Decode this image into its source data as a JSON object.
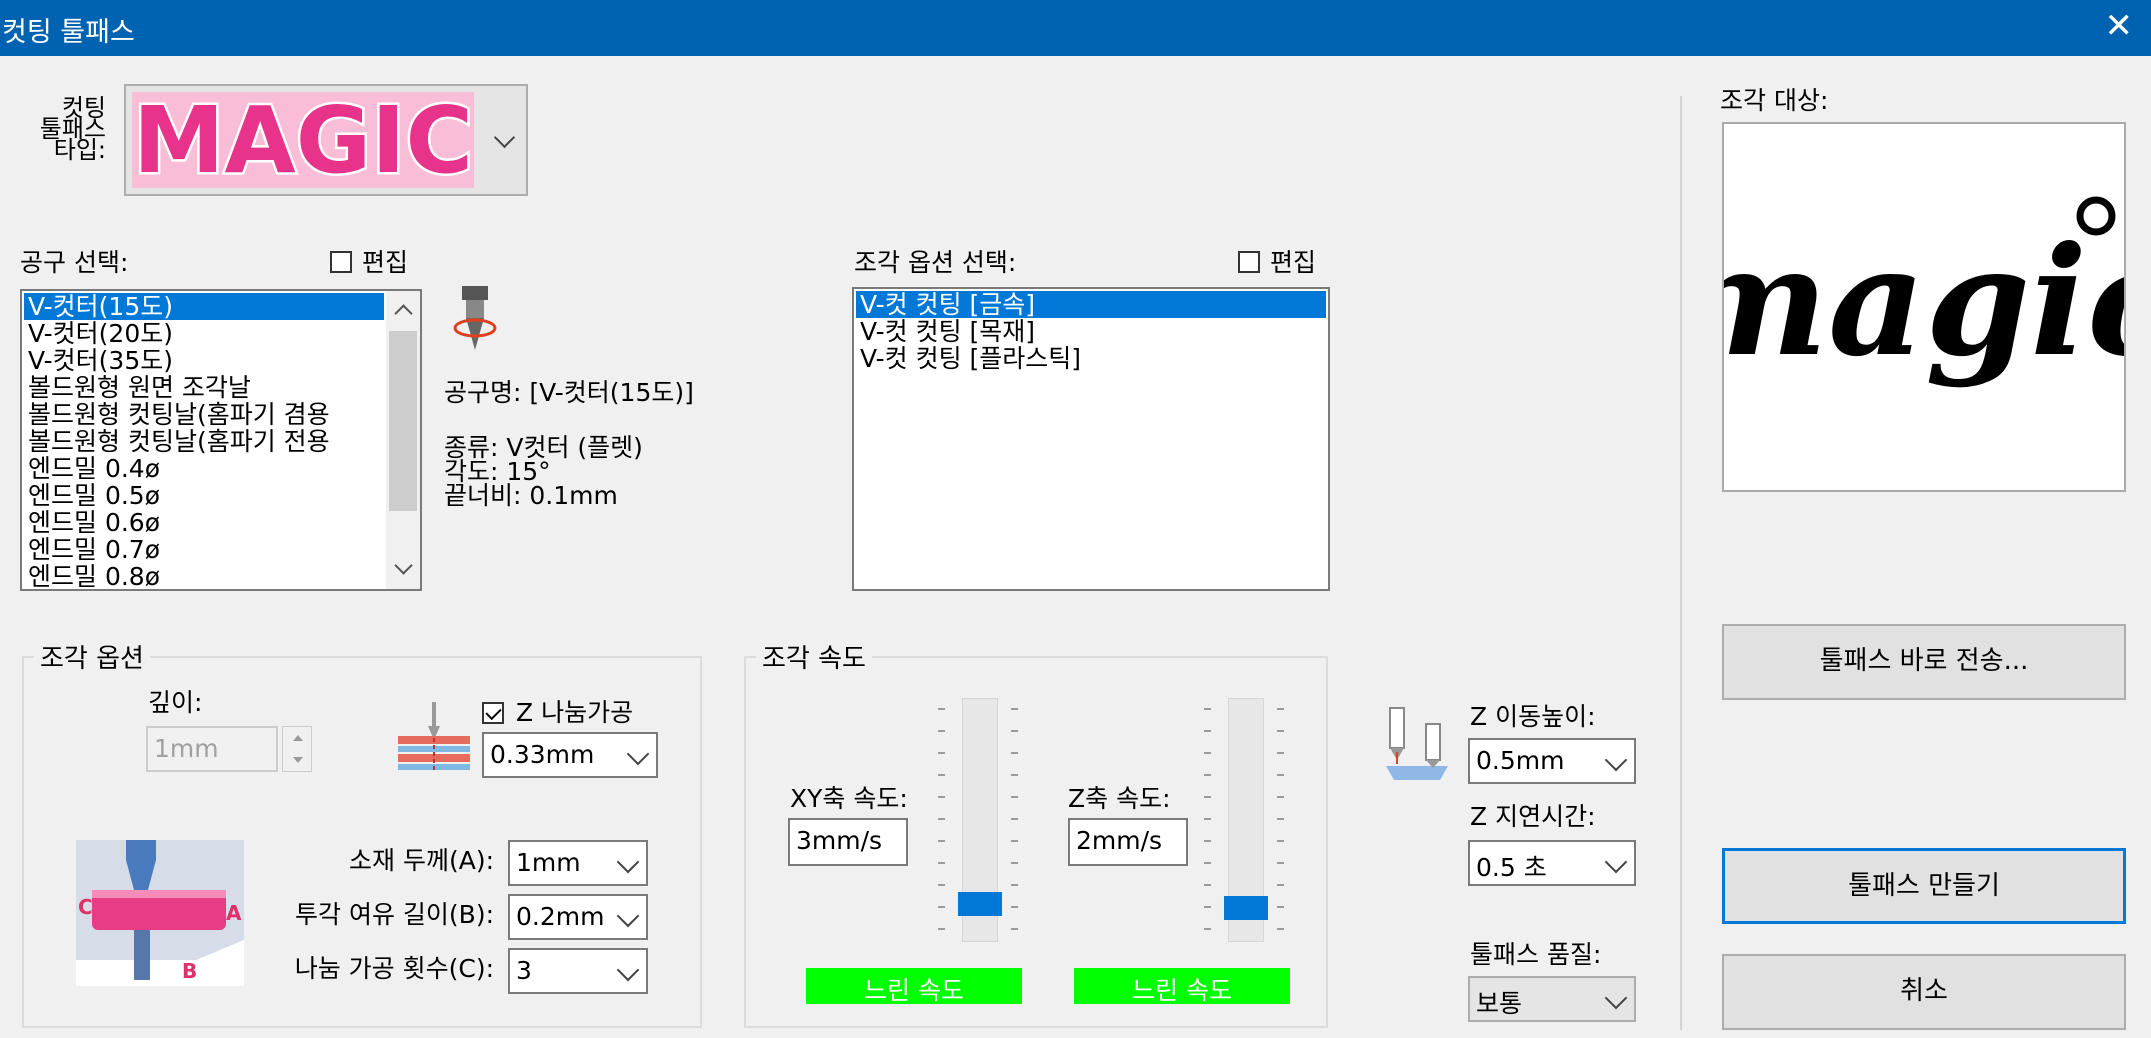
{
  "window": {
    "title": "컷팅 툴패스",
    "close_glyph": "✕"
  },
  "toolpath_type": {
    "label_lines": [
      "컷팅",
      "툴패스",
      "타입:"
    ],
    "preview_text": "MAGIC"
  },
  "tool_select": {
    "label": "공구 선택:",
    "edit_label": "편집",
    "edit_checked": false,
    "items": [
      "V-컷터(15도)",
      "V-컷터(20도)",
      "V-컷터(35도)",
      "볼드원형 원면 조각날",
      "볼드원형 컷팅날(홈파기 겸용",
      "볼드원형 컷팅날(홈파기 전용",
      "엔드밀 0.4ø",
      "엔드밀 0.5ø",
      "엔드밀 0.6ø",
      "엔드밀 0.7ø",
      "엔드밀 0.8ø"
    ],
    "selected_index": 0
  },
  "tool_info": {
    "name": "공구명: [V-컷터(15도)]",
    "type": "종류: V컷터 (플렛)",
    "angle": "각도: 15°",
    "tip_width": "끝너비: 0.1mm"
  },
  "engrave_option_select": {
    "label": "조각 옵션 선택:",
    "edit_label": "편집",
    "edit_checked": false,
    "items": [
      "V-컷 컷팅 [금속]",
      "V-컷 컷팅 [목재]",
      "V-컷 컷팅 [플라스틱]"
    ],
    "selected_index": 0
  },
  "engrave_target": {
    "label": "조각 대상:",
    "preview_text": "magic"
  },
  "engrave_options": {
    "title": "조각 옵션",
    "depth_label": "깊이:",
    "depth_value": "1mm",
    "z_split_label": "Z 나눔가공",
    "z_split_checked": true,
    "z_split_value": "0.33mm",
    "thickness_label": "소재 두께(A):",
    "thickness_value": "1mm",
    "overrun_label": "투각 여유 길이(B):",
    "overrun_value": "0.2mm",
    "passes_label": "나눔 가공 횟수(C):",
    "passes_value": "3",
    "diagram_letters": [
      "A",
      "B",
      "C"
    ]
  },
  "engrave_speed": {
    "title": "조각 속도",
    "xy_label": "XY축 속도:",
    "xy_value": "3mm/s",
    "xy_level": 0.1,
    "xy_bar_text": "느린 속도",
    "z_label": "Z축 속도:",
    "z_value": "2mm/s",
    "z_level": 0.08,
    "z_bar_text": "느린 속도"
  },
  "z_move": {
    "height_label": "Z 이동높이:",
    "height_value": "0.5mm",
    "delay_label": "Z 지연시간:",
    "delay_value": "0.5 초",
    "quality_label": "툴패스 품질:",
    "quality_value": "보통"
  },
  "buttons": {
    "send": "툴패스 바로 전송...",
    "make": "툴패스 만들기",
    "cancel": "취소"
  },
  "colors": {
    "titlebar": "#0063b1",
    "selection": "#0078d7",
    "speed_bar": "#00ff00",
    "magic_pink": "#e8338a"
  }
}
